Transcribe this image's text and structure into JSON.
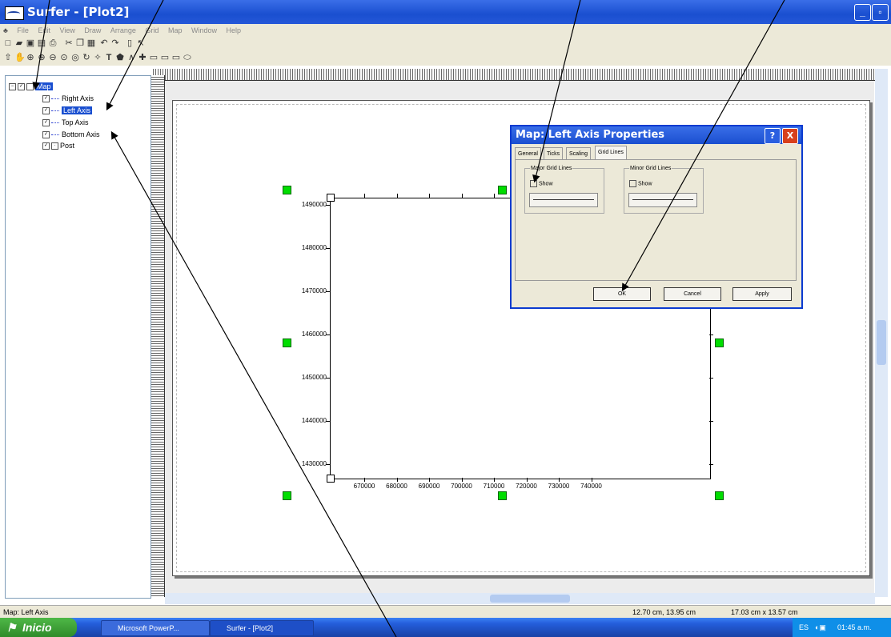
{
  "window": {
    "title": "Surfer - [Plot2]"
  },
  "menu": [
    "File",
    "Edit",
    "View",
    "Draw",
    "Arrange",
    "Grid",
    "Map",
    "Window",
    "Help"
  ],
  "tree": {
    "root": "Map",
    "items": [
      "Right Axis",
      "Left Axis",
      "Top Axis",
      "Bottom Axis",
      "Post"
    ],
    "selected": "Left Axis"
  },
  "plot": {
    "y_ticks": [
      "1490000",
      "1480000",
      "1470000",
      "1460000",
      "1450000",
      "1440000",
      "1430000"
    ],
    "x_ticks": [
      "670000",
      "680000",
      "690000",
      "700000",
      "710000",
      "720000",
      "730000",
      "740000"
    ]
  },
  "dialog": {
    "title": "Map: Left Axis Properties",
    "tabs": [
      "General",
      "Ticks",
      "Scaling",
      "Grid Lines"
    ],
    "active_tab": "Grid Lines",
    "major_group": "Major Grid Lines",
    "minor_group": "Minor Grid Lines",
    "show_label": "Show",
    "ok": "OK",
    "cancel": "Cancel",
    "apply": "Apply",
    "help_button": "?",
    "close_button": "X"
  },
  "status": {
    "left": "Map: Left Axis",
    "position": "12.70 cm, 13.95 cm",
    "size": "17.03 cm x 13.57 cm"
  },
  "taskbar": {
    "start": "Inicio",
    "tasks": [
      "Microsoft PowerP...",
      "Surfer - [Plot2]"
    ],
    "lang": "ES",
    "clock": "01:45 a.m."
  },
  "colors": {
    "handle": "#00dd00",
    "titlebar": "#1a4fd0",
    "selection": "#1a4fd0"
  }
}
